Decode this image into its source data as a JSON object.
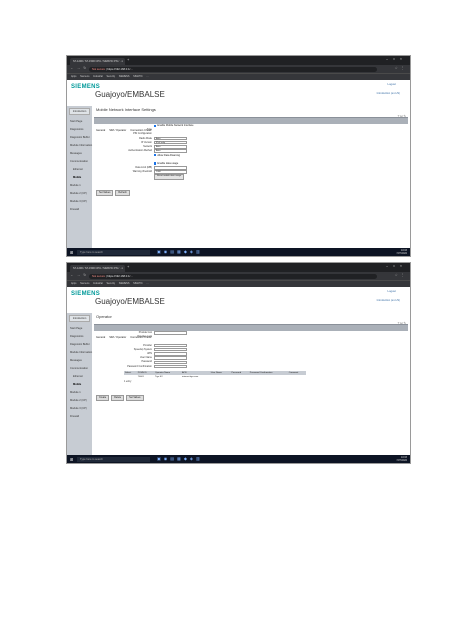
{
  "browser": {
    "tab_title": "S7-1200 / S7-1500 CPU / SIMATIC PN / …",
    "address": {
      "warning": "Not secure",
      "url": "https://192.168.0.1/..."
    },
    "bookmarks": "Apps   Siemens   Industrial Security   SIEMENS SIMATIC   …"
  },
  "screen1": {
    "brand": {
      "logo": "SIEMENS",
      "station": "Guajoyo/EMBALSE",
      "link_top": "Logout",
      "link_sub": "Introduction (en-US)"
    },
    "sidebar": {
      "button": "Introduction",
      "items": [
        "Start Page",
        "Diagnostics",
        "Diagnostic Buffer",
        "Module Information",
        "Messages",
        "Communication",
        "Topology",
        "Interfaces",
        "Ethernet",
        "Mobile",
        "Module 1",
        "Module 2 (CP)",
        "Module 3 (CP)",
        "Firewall"
      ]
    },
    "page_title": "Mobile Network Interface Settings",
    "icons": "?  ⊟  ✎",
    "tabs": [
      "General",
      "SIM / Operator",
      "Connection Check"
    ],
    "form": {
      "check1": "Enable Mobile Network Interface",
      "fields": [
        {
          "label": "Type",
          "value": ""
        },
        {
          "label": "PIN Configuration",
          "value": ""
        },
        {
          "label": "Radio Mode",
          "value": "Auto"
        },
        {
          "label": "IP Version",
          "value": "IPv4 only"
        },
        {
          "label": "Network",
          "value": "Auto"
        },
        {
          "label": "Authentication Method",
          "value": "Auto"
        }
      ],
      "check2": "Allow Data Roaming",
      "check3": "Enable data usage",
      "fields2": [
        {
          "label": "Data Limit (MB)",
          "value": ""
        },
        {
          "label": "Warning threshold",
          "value": "1000"
        }
      ],
      "reset": "Reset mobile data usage",
      "buttons": [
        "Set Values",
        "Refresh"
      ]
    }
  },
  "screen2": {
    "brand": {
      "logo": "SIEMENS",
      "station": "Guajoyo/EMBALSE",
      "link_top": "Logout",
      "link_sub": "Introduction (en-US)"
    },
    "sidebar": {
      "button": "Introduction",
      "items": [
        "Start Page",
        "Diagnostics",
        "Diagnostic Buffer",
        "Module Information",
        "Messages",
        "Communication",
        "Topology",
        "Interfaces",
        "Ethernet",
        "Mobile",
        "Module 1",
        "Module 2 (CP)",
        "Module 3 (CP)",
        "Firewall"
      ]
    },
    "page_title": "Operator",
    "icons": "?  ⊟  ✎",
    "tabs": [
      "General",
      "SIM / Operator",
      "Connection Check"
    ],
    "form": {
      "fields": [
        {
          "label": "Provider List",
          "value": ""
        },
        {
          "label": "Provider Lock",
          "value": ""
        },
        {
          "label": "Provider",
          "value": ""
        },
        {
          "label": "Speedup System",
          "value": ""
        },
        {
          "label": "APN",
          "value": ""
        },
        {
          "label": "User Name",
          "value": ""
        },
        {
          "label": "Password",
          "value": ""
        },
        {
          "label": "Password Confirmation",
          "value": ""
        }
      ],
      "table_headers": [
        "Select",
        "PLMN ID",
        "Operator Name",
        "APN",
        "User Name",
        "Password",
        "Password Confirmation",
        "Comment"
      ],
      "table_rows": [
        [
          "",
          "70601",
          "Tigo SV",
          "internet.tigo.com",
          "",
          "",
          "",
          ""
        ]
      ],
      "caption": "1 entry",
      "buttons": [
        "Create",
        "Delete",
        "Set Values"
      ]
    }
  },
  "taskbar": {
    "search": "Type here to search",
    "time": "10:03",
    "date": "7/27/2022"
  }
}
